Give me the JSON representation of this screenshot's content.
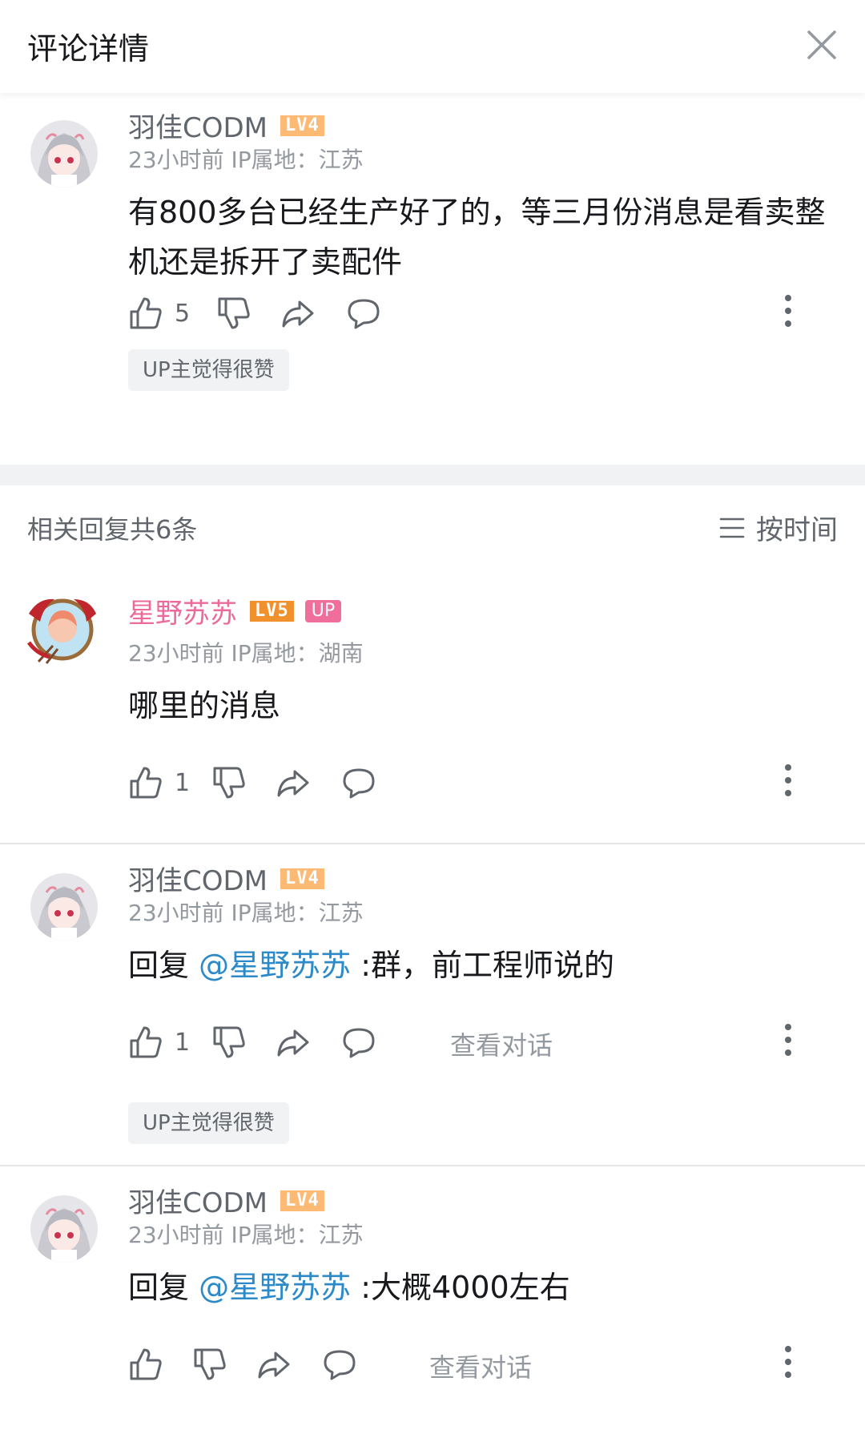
{
  "header": {
    "title": "评论详情"
  },
  "main_comment": {
    "username": "羽佳CODM",
    "level": "LV4",
    "time_ip": "23小时前  IP属地：江苏",
    "content": "有800多台已经生产好了的，等三月份消息是看卖整机还是拆开了卖配件",
    "likes": "5",
    "tag": "UP主觉得很赞"
  },
  "replies_header": {
    "count_text": "相关回复共6条",
    "sort_label": "按时间"
  },
  "replies": [
    {
      "username": "星野苏苏",
      "level": "LV5",
      "badge": "UP",
      "time_ip": "23小时前  IP属地：湖南",
      "content": "哪里的消息",
      "likes": "1"
    },
    {
      "username": "羽佳CODM",
      "level": "LV4",
      "time_ip": "23小时前  IP属地：江苏",
      "reply_prefix": "回复 ",
      "mention": "@星野苏苏",
      "content": " :群，前工程师说的",
      "likes": "1",
      "view_conversation": "查看对话",
      "tag": "UP主觉得很赞"
    },
    {
      "username": "羽佳CODM",
      "level": "LV4",
      "time_ip": "23小时前  IP属地：江苏",
      "reply_prefix": "回复 ",
      "mention": "@星野苏苏",
      "content": " :大概4000左右",
      "likes": "",
      "view_conversation": "查看对话"
    }
  ],
  "icons": {
    "close": "close-icon",
    "like": "thumbs-up-icon",
    "dislike": "thumbs-down-icon",
    "share": "share-icon",
    "comment": "comment-icon",
    "more": "more-vertical-icon",
    "sort": "sort-lines-icon"
  },
  "colors": {
    "up_name": "#eb6a9a",
    "mention": "#2c8ac9",
    "lv4": "#fdba74",
    "lv5": "#f0912d",
    "up_badge": "#f06e9c"
  }
}
